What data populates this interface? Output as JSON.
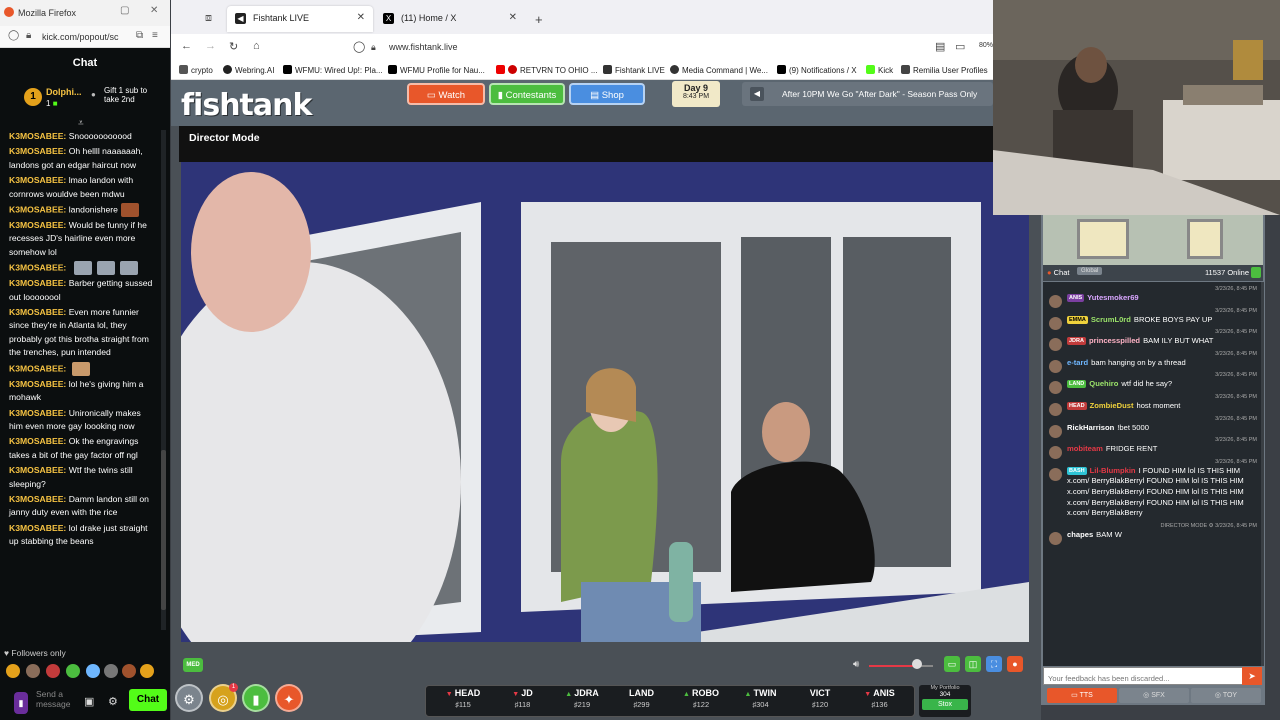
{
  "left_window": {
    "title": "Mozilla Firefox",
    "url": "kick.com/popout/sc",
    "chat_header": "Chat",
    "gift": {
      "user": "Dolphi...",
      "count": "1",
      "badge": "1",
      "text": "Gift 1 sub to take 2nd"
    },
    "messages": [
      {
        "user": "K3MOSABEE:",
        "text": "Snooooooooood"
      },
      {
        "user": "K3MOSABEE:",
        "text": "Oh hellll naaaaaah, landons got an edgar haircut now"
      },
      {
        "user": "K3MOSABEE:",
        "text": "lmao landon with cornrows wouldve been mdwu"
      },
      {
        "user": "K3MOSABEE:",
        "text": "landonishere",
        "emote": "#a0522d"
      },
      {
        "user": "K3MOSABEE:",
        "text": "Would be funny if he recesses JD's hairline even more somehow lol"
      },
      {
        "user": "K3MOSABEE:",
        "text": "",
        "emotes": 3
      },
      {
        "user": "K3MOSABEE:",
        "text": "Barber getting sussed out loooooool"
      },
      {
        "user": "K3MOSABEE:",
        "text": "Even more funnier since they're in Atlanta lol, they probably got this brotha straight from the trenches, pun intended"
      },
      {
        "user": "K3MOSABEE:",
        "text": "",
        "emote": "#c99a6b"
      },
      {
        "user": "K3MOSABEE:",
        "text": "lol he's giving him a mohawk"
      },
      {
        "user": "K3MOSABEE:",
        "text": "Unironically makes him even more gay loooking now"
      },
      {
        "user": "K3MOSABEE:",
        "text": "Ok the engravings takes a bit of the gay factor off ngl"
      },
      {
        "user": "K3MOSABEE:",
        "text": "Wtf the twins still sleeping?"
      },
      {
        "user": "K3MOSABEE:",
        "text": "Damm landon still on janny duty even with the rice"
      },
      {
        "user": "K3MOSABEE:",
        "text": "lol drake just straight up stabbing the beans"
      }
    ],
    "followers_only": "Followers only",
    "input_placeholder": "Send a message",
    "chat_button": "Chat"
  },
  "browser": {
    "tabs": [
      {
        "label": "Fishtank LIVE",
        "active": true
      },
      {
        "label": "(11) Home / X",
        "active": false
      }
    ],
    "url": "www.fishtank.live",
    "zoom": "80%",
    "bookmarks": [
      "crypto",
      "Webring.AI",
      "WFMU: Wired Up!: Pla...",
      "WFMU Profile for Nau...",
      "RETVRN TO OHIO ...",
      "Fishtank LIVE",
      "Media Command | We...",
      "(9) Notifications / X",
      "Kick",
      "Remilia User Profiles"
    ]
  },
  "fishtank": {
    "logo": "fishtank",
    "nav": {
      "watch": "Watch",
      "contestants": "Contestants",
      "shop": "Shop"
    },
    "day": "Day 9",
    "time": "8:43 PM",
    "marquee": "After 10PM We Go \"After Dark\" - Season Pass Only",
    "director_mode": "Director Mode",
    "quality_badge": "MED",
    "volume": 0.75,
    "contestants": [
      {
        "name": "HEAD",
        "value": "115",
        "trend": "down"
      },
      {
        "name": "JD",
        "value": "118",
        "trend": "down"
      },
      {
        "name": "JDRA",
        "value": "219",
        "trend": "up"
      },
      {
        "name": "LAND",
        "value": "299",
        "trend": "none"
      },
      {
        "name": "ROBO",
        "value": "122",
        "trend": "up"
      },
      {
        "name": "TWIN",
        "value": "304",
        "trend": "up"
      },
      {
        "name": "VICT",
        "value": "120",
        "trend": "none"
      },
      {
        "name": "ANIS",
        "value": "136",
        "trend": "down"
      }
    ],
    "portfolio": {
      "label": "My Portfolio",
      "value": "304",
      "button": "Stox"
    },
    "notification_badge": "1"
  },
  "ft_chat": {
    "title": "Chat",
    "scope": "Global",
    "online": "11537 Online",
    "messages": [
      {
        "ts": "3/23/26, 8:45 PM",
        "tag": "ANIS",
        "tag_color": "#7b3fa0",
        "user": "Yutesmoker69",
        "user_color": "#d9a6ff",
        "text": ""
      },
      {
        "ts": "3/23/26, 8:45 PM",
        "tag": "EMMA",
        "tag_color": "#f0d23c",
        "user": "ScrumL0rd",
        "user_color": "#9be36a",
        "text": "BROKE BOYS PAY UP"
      },
      {
        "ts": "3/23/26, 8:45 PM",
        "tag": "JDRA",
        "tag_color": "#c23b3b",
        "user": "princesspilled",
        "user_color": "#ffb3c6",
        "text": "BAM ILY BUT WHAT"
      },
      {
        "ts": "3/23/26, 8:45 PM",
        "tag": "",
        "tag_color": "",
        "user": "e-tard",
        "user_color": "#6fb7ff",
        "text": "bam hanging on by a thread"
      },
      {
        "ts": "3/23/26, 8:45 PM",
        "tag": "LAND",
        "tag_color": "#4cbd3f",
        "user": "Quehiro",
        "user_color": "#9be36a",
        "text": "wtf did he say?"
      },
      {
        "ts": "3/23/26, 8:45 PM",
        "tag": "HEAD",
        "tag_color": "#c23b3b",
        "user": "ZombieDust",
        "user_color": "#f0d23c",
        "text": "host moment"
      },
      {
        "ts": "3/23/26, 8:45 PM",
        "tag": "",
        "tag_color": "",
        "user": "RickHarrison",
        "user_color": "#ffffff",
        "text": "!bet 5000"
      },
      {
        "ts": "3/23/26, 8:45 PM",
        "tag": "",
        "tag_color": "",
        "user": "mobiteam",
        "user_color": "#e63946",
        "text": "FRIDGE RENT"
      },
      {
        "ts": "3/23/26, 8:45 PM",
        "tag": "BASH",
        "tag_color": "#2ec4d6",
        "user": "Lil-Blumpkin",
        "user_color": "#e63946",
        "text": "I FOUND HIM lol IS THIS HIM x.com/ BerryBlakBerryl FOUND HIM lol IS THIS HIM x.com/ BerryBlakBerryl FOUND HIM lol IS THIS HIM x.com/ BerryBlakBerryl FOUND HIM lol IS THIS HIM x.com/ BerryBlakBerry"
      },
      {
        "ts": "DIRECTOR MODE ⚙ 3/23/26, 8:45 PM",
        "tag": "",
        "tag_color": "",
        "user": "chapes",
        "user_color": "#ffffff",
        "text": "BAM W"
      }
    ],
    "input_placeholder": "Your feedback has been discarded...",
    "tabs": [
      "TTS",
      "SFX",
      "TOY"
    ]
  }
}
